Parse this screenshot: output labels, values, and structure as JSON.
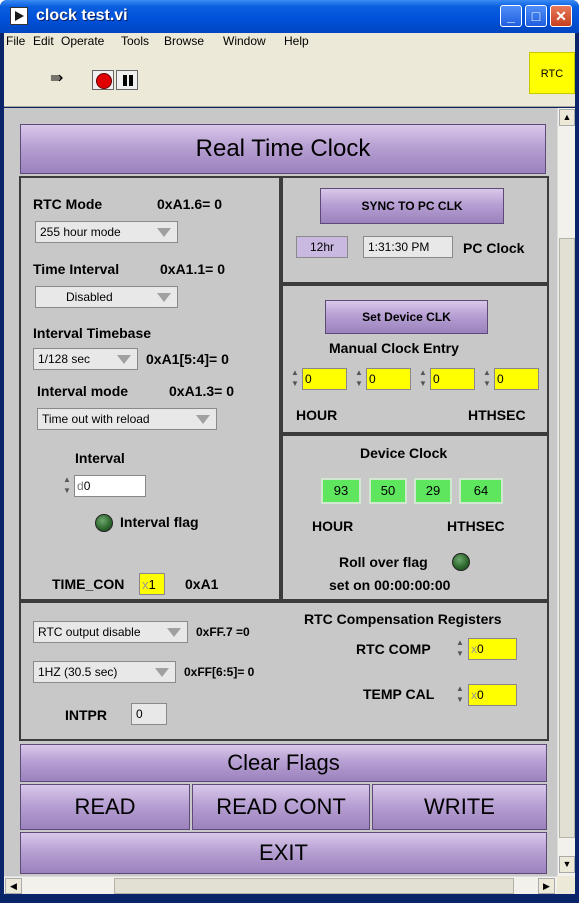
{
  "window": {
    "title": "clock test.vi"
  },
  "menu": [
    "File",
    "Edit",
    "Operate",
    "Tools",
    "Browse",
    "Window",
    "Help"
  ],
  "toolbar": {
    "rtc_badge": "RTC"
  },
  "panel": {
    "title": "Real Time Clock",
    "rtc_mode": {
      "label": "RTC  Mode",
      "reg": "0xA1.6= 0",
      "value": "255 hour mode"
    },
    "time_interval": {
      "label": "Time Interval",
      "reg": "0xA1.1= 0",
      "value": "Disabled"
    },
    "interval_timebase": {
      "label": "Interval Timebase",
      "value": "1/128 sec",
      "reg": "0xA1[5:4]= 0"
    },
    "interval_mode": {
      "label": "Interval mode",
      "reg": "0xA1.3= 0",
      "value": "Time out with reload"
    },
    "interval": {
      "label": "Interval",
      "value": "0",
      "prefix": "d"
    },
    "interval_flag": {
      "label": "Interval flag"
    },
    "time_con": {
      "label": "TIME_CON",
      "prefix": "x",
      "value": "1",
      "reg": "0xA1"
    },
    "sync": {
      "button": "SYNC TO PC CLK",
      "format": "12hr",
      "time": "1:31:30 PM",
      "label": "PC Clock"
    },
    "manual": {
      "button": "Set Device CLK",
      "title": "Manual Clock Entry",
      "values": [
        "0",
        "0",
        "0",
        "0"
      ],
      "hour_label": "HOUR",
      "hthsec_label": "HTHSEC"
    },
    "device_clock": {
      "title": "Device Clock",
      "values": [
        "93",
        "50",
        "29",
        "64"
      ],
      "hour_label": "HOUR",
      "hthsec_label": "HTHSEC",
      "roll_over": "Roll over flag",
      "set_on": "set on 00:00:00:00"
    },
    "output": {
      "rtc_output": "RTC output disable",
      "rtc_output_reg": "0xFF.7 =0",
      "freq": "1HZ  (30.5 sec)",
      "freq_reg": "0xFF[6:5]= 0",
      "intpr_label": "INTPR",
      "intpr_value": "0"
    },
    "compensation": {
      "title": "RTC Compensation Registers",
      "rtc_comp_label": "RTC  COMP",
      "rtc_comp_prefix": "x",
      "rtc_comp_value": "0",
      "temp_cal_label": "TEMP CAL",
      "temp_cal_prefix": "x",
      "temp_cal_value": "0"
    },
    "buttons": {
      "clear_flags": "Clear Flags",
      "read": "READ",
      "read_cont": "READ CONT",
      "write": "WRITE",
      "exit": "EXIT"
    }
  }
}
